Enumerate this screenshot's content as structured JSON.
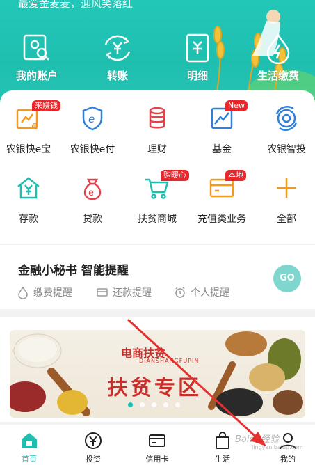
{
  "header": {
    "slogan": "最爱金麦麦，迎风笑落红",
    "quick": [
      {
        "label": "我的账户",
        "icon": "account-search-icon"
      },
      {
        "label": "转账",
        "icon": "transfer-yen-icon"
      },
      {
        "label": "明细",
        "icon": "statement-icon"
      },
      {
        "label": "生活缴费",
        "icon": "drop-bolt-icon"
      }
    ]
  },
  "grid": {
    "row1": [
      {
        "label": "农银快e宝",
        "badge": "来赚钱",
        "icon": "e-treasure-icon"
      },
      {
        "label": "农银快e付",
        "badge": "",
        "icon": "shield-e-icon"
      },
      {
        "label": "理财",
        "badge": "",
        "icon": "coin-stack-icon"
      },
      {
        "label": "基金",
        "badge": "New",
        "icon": "trend-chart-icon"
      },
      {
        "label": "农银智投",
        "badge": "",
        "icon": "robot-invest-icon"
      }
    ],
    "row2": [
      {
        "label": "存款",
        "badge": "",
        "icon": "house-yen-icon"
      },
      {
        "label": "贷款",
        "badge": "",
        "icon": "money-bag-icon"
      },
      {
        "label": "扶贫商城",
        "badge": "购暖心",
        "icon": "shopping-cart-icon"
      },
      {
        "label": "充值类业务",
        "badge": "本地",
        "icon": "recharge-card-icon"
      },
      {
        "label": "全部",
        "badge": "",
        "icon": "plus-icon"
      }
    ]
  },
  "secretary": {
    "title": "金融小秘书 智能提醒",
    "items": [
      "缴费提醒",
      "还款提醒",
      "个人提醒"
    ],
    "go": "GO"
  },
  "banner": {
    "logo": "电商扶贫",
    "logo_sub": "DIANSHANGFUPIN",
    "title": "扶贫专区"
  },
  "nav": [
    {
      "label": "首页",
      "icon": "home-icon",
      "active": true
    },
    {
      "label": "投资",
      "icon": "yen-circle-icon",
      "active": false
    },
    {
      "label": "信用卡",
      "icon": "credit-card-icon",
      "active": false
    },
    {
      "label": "生活",
      "icon": "shopping-bag-icon",
      "active": false
    },
    {
      "label": "我的",
      "icon": "user-icon",
      "active": false
    }
  ],
  "watermark": {
    "text": "Baidu经验",
    "sub": "jingyan.baidu.com"
  },
  "colors": {
    "brand": "#1fbfb0",
    "badge": "#e8262b",
    "accent_orange": "#f39a1e"
  }
}
